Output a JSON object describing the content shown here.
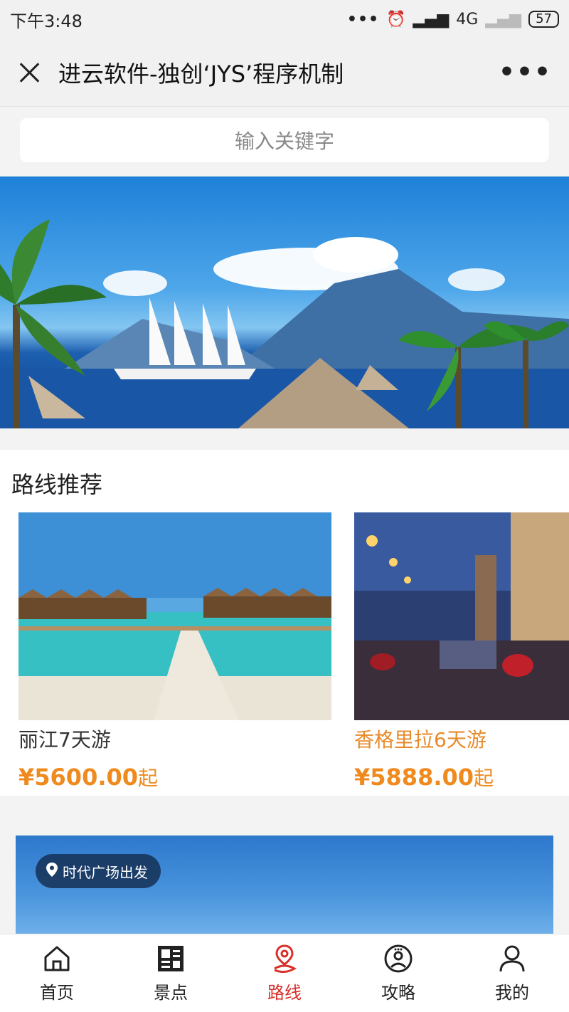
{
  "status_bar": {
    "time": "下午3:48",
    "network": "4G",
    "battery": "57"
  },
  "nav": {
    "title": "进云软件-独创‘JYS’程序机制"
  },
  "search": {
    "placeholder": "输入关键字"
  },
  "section": {
    "title": "路线推荐",
    "cards": [
      {
        "name": "丽江7天游",
        "price": "¥5600.00",
        "suffix": "起"
      },
      {
        "name": "香格里拉6天游",
        "price": "¥5888.00",
        "suffix": "起"
      }
    ]
  },
  "banner2": {
    "location": "时代广场出发"
  },
  "tabs": [
    {
      "label": "首页",
      "icon": "home-icon"
    },
    {
      "label": "景点",
      "icon": "grid-icon"
    },
    {
      "label": "路线",
      "icon": "route-icon",
      "active": true
    },
    {
      "label": "攻略",
      "icon": "guide-icon"
    },
    {
      "label": "我的",
      "icon": "user-icon"
    }
  ],
  "colors": {
    "accent_red": "#d8302a",
    "price_orange": "#ef8a1f"
  }
}
